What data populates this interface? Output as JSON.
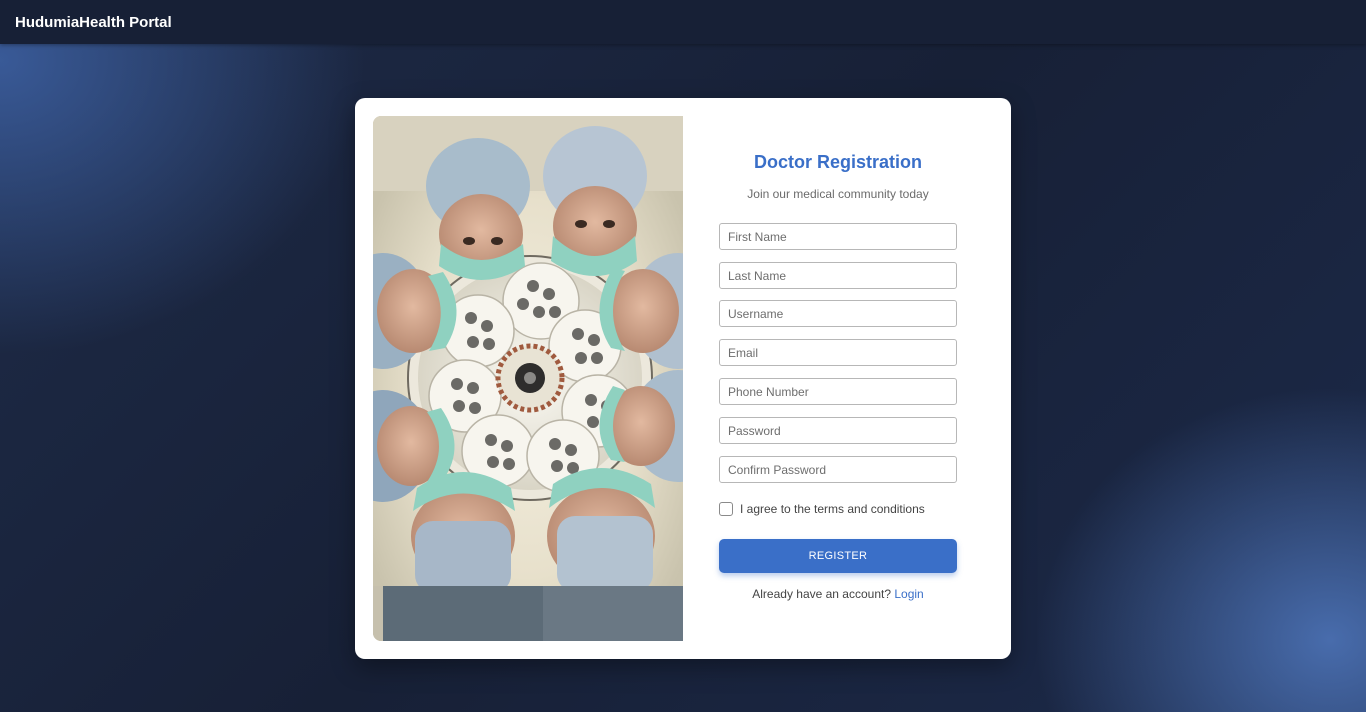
{
  "app": {
    "title": "HudumiaHealth Portal"
  },
  "form": {
    "title": "Doctor Registration",
    "subtitle": "Join our medical community today",
    "fields": {
      "first_name": {
        "placeholder": "First Name",
        "value": ""
      },
      "last_name": {
        "placeholder": "Last Name",
        "value": ""
      },
      "username": {
        "placeholder": "Username",
        "value": ""
      },
      "email": {
        "placeholder": "Email",
        "value": ""
      },
      "phone": {
        "placeholder": "Phone Number",
        "value": ""
      },
      "password": {
        "placeholder": "Password",
        "value": ""
      },
      "confirm_password": {
        "placeholder": "Confirm Password",
        "value": ""
      }
    },
    "terms": {
      "label": "I agree to the terms and conditions",
      "checked": false
    },
    "register_label": "REGISTER",
    "login_prompt": "Already have an account?",
    "login_link": "Login"
  },
  "image": {
    "subject": "surgeons-looking-down-photo"
  },
  "colors": {
    "accent": "#3a6fc8",
    "topbar": "#172036"
  }
}
